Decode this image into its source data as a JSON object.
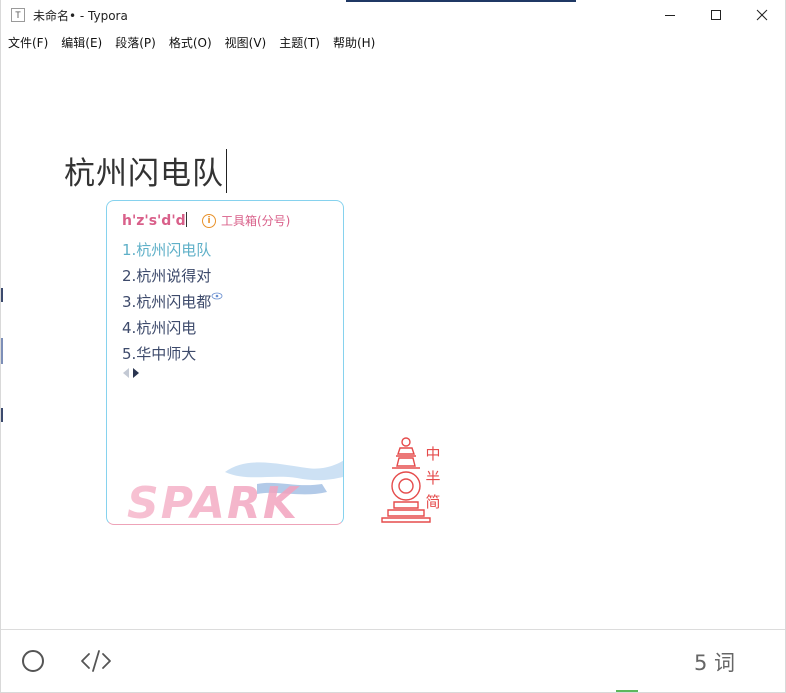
{
  "window": {
    "app_icon_letter": "T",
    "title": "未命名• - Typora"
  },
  "menu": [
    "文件(F)",
    "编辑(E)",
    "段落(P)",
    "格式(O)",
    "视图(V)",
    "主题(T)",
    "帮助(H)"
  ],
  "editor": {
    "heading": "杭州闪电队"
  },
  "ime": {
    "composition": "h'z's'd'd",
    "toolbox_icon_glyph": "i",
    "toolbox_label": "工具箱(分号)",
    "candidates": [
      {
        "text": "1.杭州闪电队"
      },
      {
        "text": "2.杭州说得对"
      },
      {
        "text": "3.杭州闪电都"
      },
      {
        "text": "4.杭州闪电"
      },
      {
        "text": "5.华中师大"
      }
    ],
    "skin_logo": "SPARK",
    "colors": {
      "composition": "#d9608a",
      "active_candidate": "#5fb0c8",
      "candidate": "#3d4a6b",
      "border_top": "#86d2ee",
      "border_bottom": "#eea3b8"
    }
  },
  "seal": {
    "chars": [
      "中",
      "半",
      "简"
    ],
    "color": "#e54b4b"
  },
  "statusbar": {
    "word_count": "5 词"
  }
}
